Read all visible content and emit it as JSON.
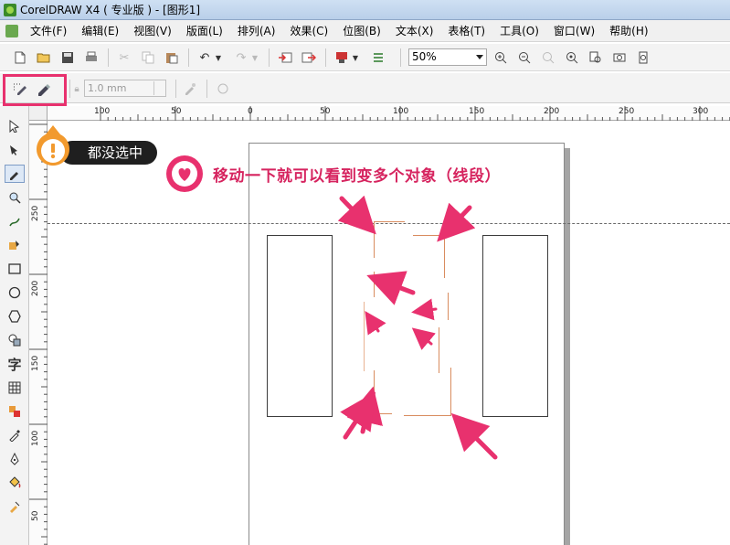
{
  "window": {
    "title": "CorelDRAW X4 ( 专业版 ) - [图形1]"
  },
  "menu": {
    "items": [
      {
        "label": "文件(F)"
      },
      {
        "label": "编辑(E)"
      },
      {
        "label": "视图(V)"
      },
      {
        "label": "版面(L)"
      },
      {
        "label": "排列(A)"
      },
      {
        "label": "效果(C)"
      },
      {
        "label": "位图(B)"
      },
      {
        "label": "文本(X)"
      },
      {
        "label": "表格(T)"
      },
      {
        "label": "工具(O)"
      },
      {
        "label": "窗口(W)"
      },
      {
        "label": "帮助(H)"
      }
    ]
  },
  "toolbar": {
    "zoom_value": "50%"
  },
  "property_bar": {
    "nib_width": "1.0 mm"
  },
  "ruler_h": {
    "labels": [
      "100",
      "50",
      "0",
      "50",
      "100",
      "150",
      "200",
      "250",
      "300"
    ]
  },
  "ruler_v": {
    "labels": [
      "250",
      "200",
      "150",
      "100",
      "50"
    ]
  },
  "annotations": {
    "callout_left": "都没选中",
    "callout_main": "移动一下就可以看到变多个对象（线段）"
  },
  "colors": {
    "annotation_accent": "#e8316e",
    "segment_color": "#d98c5f",
    "callout_orange": "#f29a2e"
  }
}
